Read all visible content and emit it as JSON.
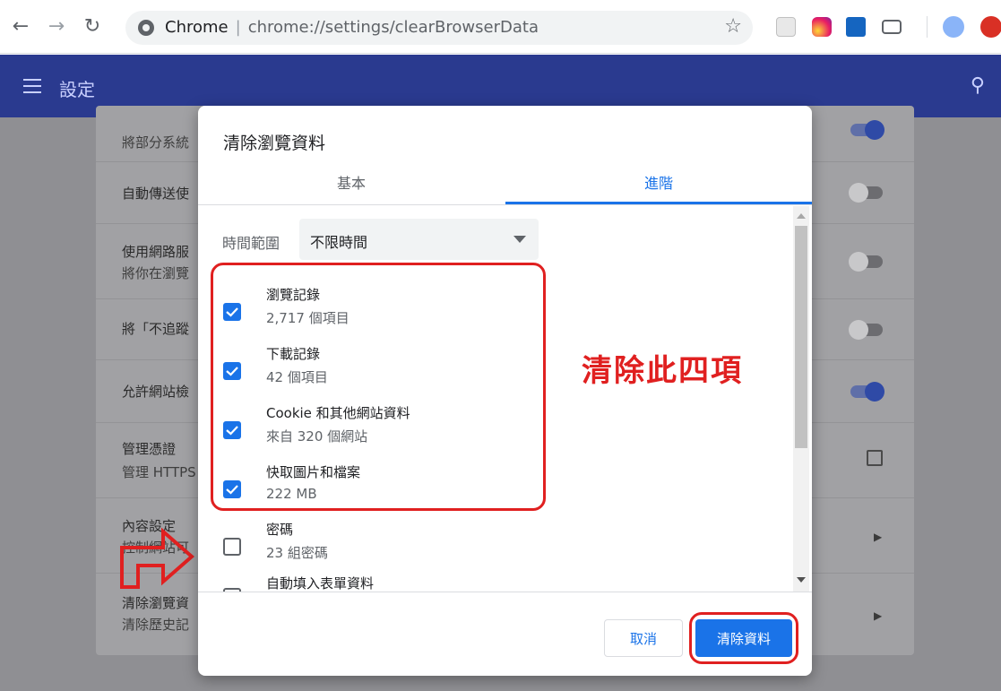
{
  "browser": {
    "tab_site": "Chrome",
    "url_path": "chrome://settings/clearBrowserData",
    "icons": [
      "back-icon",
      "forward-icon",
      "reload-icon",
      "star-icon",
      "pdf-extension-icon",
      "instagram-extension-icon",
      "download-extension-icon",
      "cast-icon",
      "profile-avatar-icon",
      "update-icon"
    ]
  },
  "header": {
    "title": "設定"
  },
  "settings_rows": [
    {
      "title": "",
      "sub": "將部分系統"
    },
    {
      "title": "自動傳送使",
      "sub": ""
    },
    {
      "title": "使用網路服",
      "sub": "將你在瀏覽"
    },
    {
      "title": "將「不追蹤",
      "sub": ""
    },
    {
      "title": "允許網站檢",
      "sub": ""
    },
    {
      "title": "管理憑證",
      "sub": "管理 HTTPS"
    },
    {
      "title": "內容設定",
      "sub": "控制網站可"
    },
    {
      "title": "清除瀏覽資",
      "sub": "清除歷史記"
    }
  ],
  "dialog": {
    "title": "清除瀏覽資料",
    "tabs": {
      "basic": "基本",
      "advanced": "進階",
      "selected": "advanced"
    },
    "time_range": {
      "label": "時間範圍",
      "value": "不限時間"
    },
    "items": [
      {
        "label": "瀏覽記錄",
        "sub": "2,717 個項目",
        "checked": true
      },
      {
        "label": "下載記錄",
        "sub": "42 個項目",
        "checked": true
      },
      {
        "label": "Cookie 和其他網站資料",
        "sub": "來自 320 個網站",
        "checked": true
      },
      {
        "label": "快取圖片和檔案",
        "sub": "222 MB",
        "checked": true
      },
      {
        "label": "密碼",
        "sub": "23 組密碼",
        "checked": false
      },
      {
        "label": "自動填入表單資料",
        "sub": "",
        "checked": false
      }
    ],
    "annotation": "清除此四項",
    "buttons": {
      "cancel": "取消",
      "clear": "清除資料"
    }
  },
  "colors": {
    "accent": "#1a73e8",
    "header": "#2a3a8f",
    "annotation": "#e02020"
  }
}
